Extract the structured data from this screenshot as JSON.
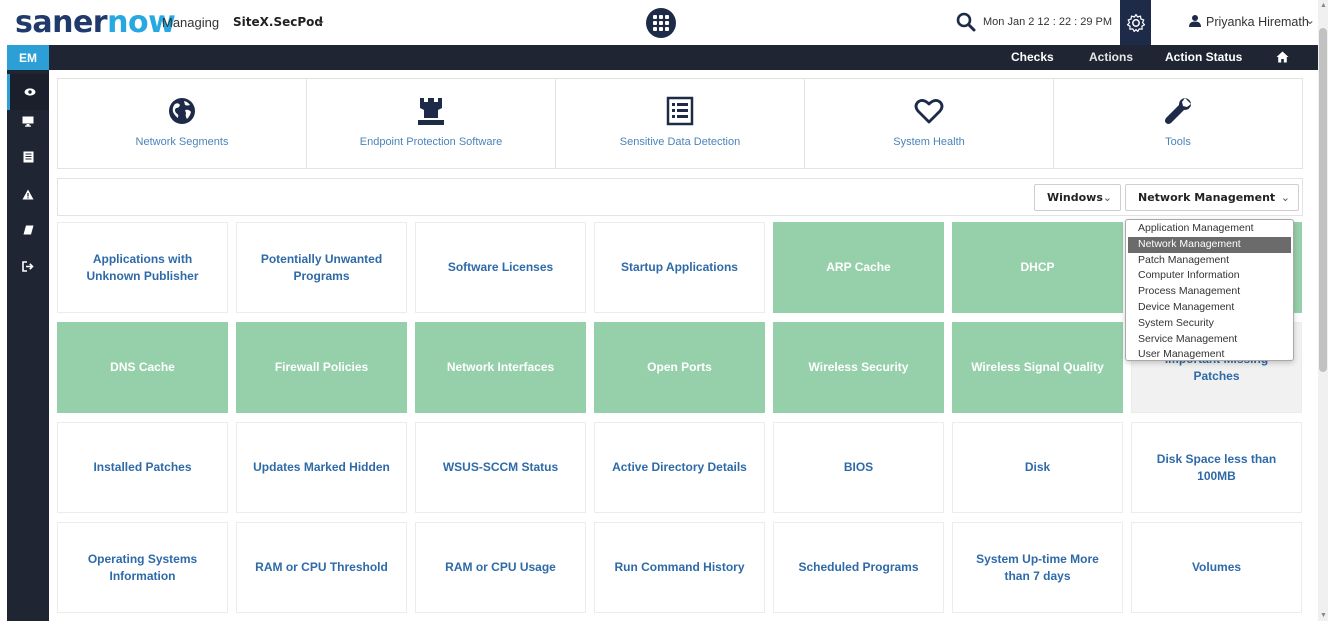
{
  "header": {
    "logo_part1": "saner",
    "logo_part2": "now",
    "managing_label": "Managing",
    "site_name": "SiteX.SecPod",
    "datetime": "Mon Jan 2  12 : 22 : 29 PM",
    "username": "Priyanka Hiremath"
  },
  "nav": {
    "checks": "Checks",
    "actions": "Actions",
    "action_status": "Action Status"
  },
  "sidebar": {
    "badge": "EM",
    "icons": [
      "eye-icon",
      "monitor-icon",
      "document-icon",
      "warning-icon",
      "eraser-icon",
      "logout-icon"
    ]
  },
  "categories": [
    {
      "label": "Network Segments",
      "icon": "globe-icon"
    },
    {
      "label": "Endpoint Protection Software",
      "icon": "castle-icon"
    },
    {
      "label": "Sensitive Data Detection",
      "icon": "list-icon"
    },
    {
      "label": "System Health",
      "icon": "heart-icon"
    },
    {
      "label": "Tools",
      "icon": "wrench-icon"
    }
  ],
  "filters": {
    "os": "Windows",
    "category": "Network Management"
  },
  "dropdown": {
    "options": [
      "Application Management",
      "Network Management",
      "Patch Management",
      "Computer Information",
      "Process Management",
      "Device Management",
      "System Security",
      "Service Management",
      "User Management"
    ],
    "selected_index": 1
  },
  "tiles": [
    [
      "Applications with Unknown Publisher",
      "Potentially Unwanted Programs",
      "Software Licenses",
      "Startup Applications",
      "ARP Cache",
      "DHCP",
      ""
    ],
    [
      "DNS Cache",
      "Firewall Policies",
      "Network Interfaces",
      "Open Ports",
      "Wireless Security",
      "Wireless Signal Quality",
      "Important Missing Patches"
    ],
    [
      "Installed Patches",
      "Updates Marked Hidden",
      "WSUS-SCCM Status",
      "Active Directory Details",
      "BIOS",
      "Disk",
      "Disk Space less than 100MB"
    ],
    [
      "Operating Systems Information",
      "RAM or CPU Threshold",
      "RAM or CPU Usage",
      "Run Command History",
      "Scheduled Programs",
      "System Up-time More than 7 days",
      "Volumes"
    ]
  ],
  "tile_highlight": [
    [
      false,
      false,
      false,
      false,
      true,
      true,
      true
    ],
    [
      true,
      true,
      true,
      true,
      true,
      true,
      false
    ],
    [
      false,
      false,
      false,
      false,
      false,
      false,
      false
    ],
    [
      false,
      false,
      false,
      false,
      false,
      false,
      false
    ]
  ],
  "colors": {
    "highlight": "#96d0ab",
    "nav_bg": "#1f2533",
    "accent": "#2b9fd6",
    "link": "#2e6aa8"
  }
}
